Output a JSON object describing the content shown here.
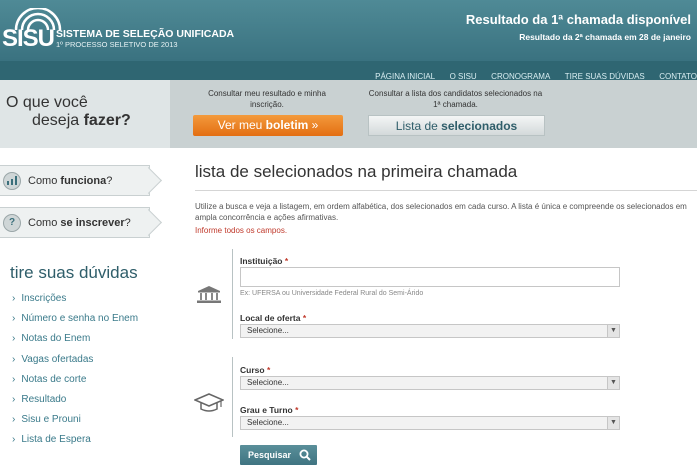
{
  "header": {
    "logo_text": "SISU",
    "system_title": "SISTEMA DE SELEÇÃO UNIFICADA",
    "system_subtitle": "1º PROCESSO SELETIVO DE 2013",
    "announcement_1": "Resultado da 1ª chamada disponível",
    "announcement_2": "Resultado da 2ª chamada em 28 de janeiro"
  },
  "nav": {
    "items": [
      "PÁGINA INICIAL",
      "O SISU",
      "CRONOGRAMA",
      "TIRE SUAS DÚVIDAS",
      "CONTATO"
    ]
  },
  "band": {
    "question_1": "O que você",
    "question_2_prefix": "deseja ",
    "question_2_bold": "fazer?",
    "hint_1": "Consultar meu resultado e minha inscrição.",
    "hint_2": "Consultar a lista dos candidatos selecionados na 1ª chamada.",
    "btn_boletim_prefix": "Ver meu ",
    "btn_boletim_bold": "boletim",
    "btn_boletim_arrow": "»",
    "btn_lista_prefix": "Lista de ",
    "btn_lista_bold": "selecionados"
  },
  "sidebar": {
    "box_1_icon": "bar-chart-icon",
    "box_1_prefix": "Como ",
    "box_1_bold": "funciona",
    "box_1_suffix": "?",
    "box_2_icon": "question-icon",
    "box_2_icon_glyph": "?",
    "box_2_prefix": "Como ",
    "box_2_bold": "se inscrever",
    "box_2_suffix": "?",
    "faq_title": "tire suas dúvidas",
    "faq_items": [
      "Inscrições",
      "Número e senha no Enem",
      "Notas do Enem",
      "Vagas ofertadas",
      "Notas de corte",
      "Resultado",
      "Sisu e Prouni",
      "Lista de Espera"
    ]
  },
  "main": {
    "title": "lista de selecionados na primeira chamada",
    "description": "Utilize a busca e veja a listagem, em ordem alfabética, dos selecionados em cada curso. A lista é única e compreende os selecionados em ampla concorrência e ações afirmativas.",
    "required_note": "Informe todos os campos.",
    "institution_label": "Instituição",
    "institution_value": "",
    "institution_example": "Ex: UFERSA ou Universidade Federal Rural do Semi-Árido",
    "offer_label": "Local de oferta",
    "offer_value": "Selecione...",
    "course_label": "Curso",
    "course_value": "Selecione...",
    "degree_label": "Grau e Turno",
    "degree_value": "Selecione...",
    "required_marker": "*",
    "search_button": "Pesquisar"
  },
  "colors": {
    "header": "#3f7a86",
    "nav": "#2f6672",
    "orange_button": "#e87a1c",
    "required": "#c0392b",
    "link": "#3a7a8a"
  }
}
